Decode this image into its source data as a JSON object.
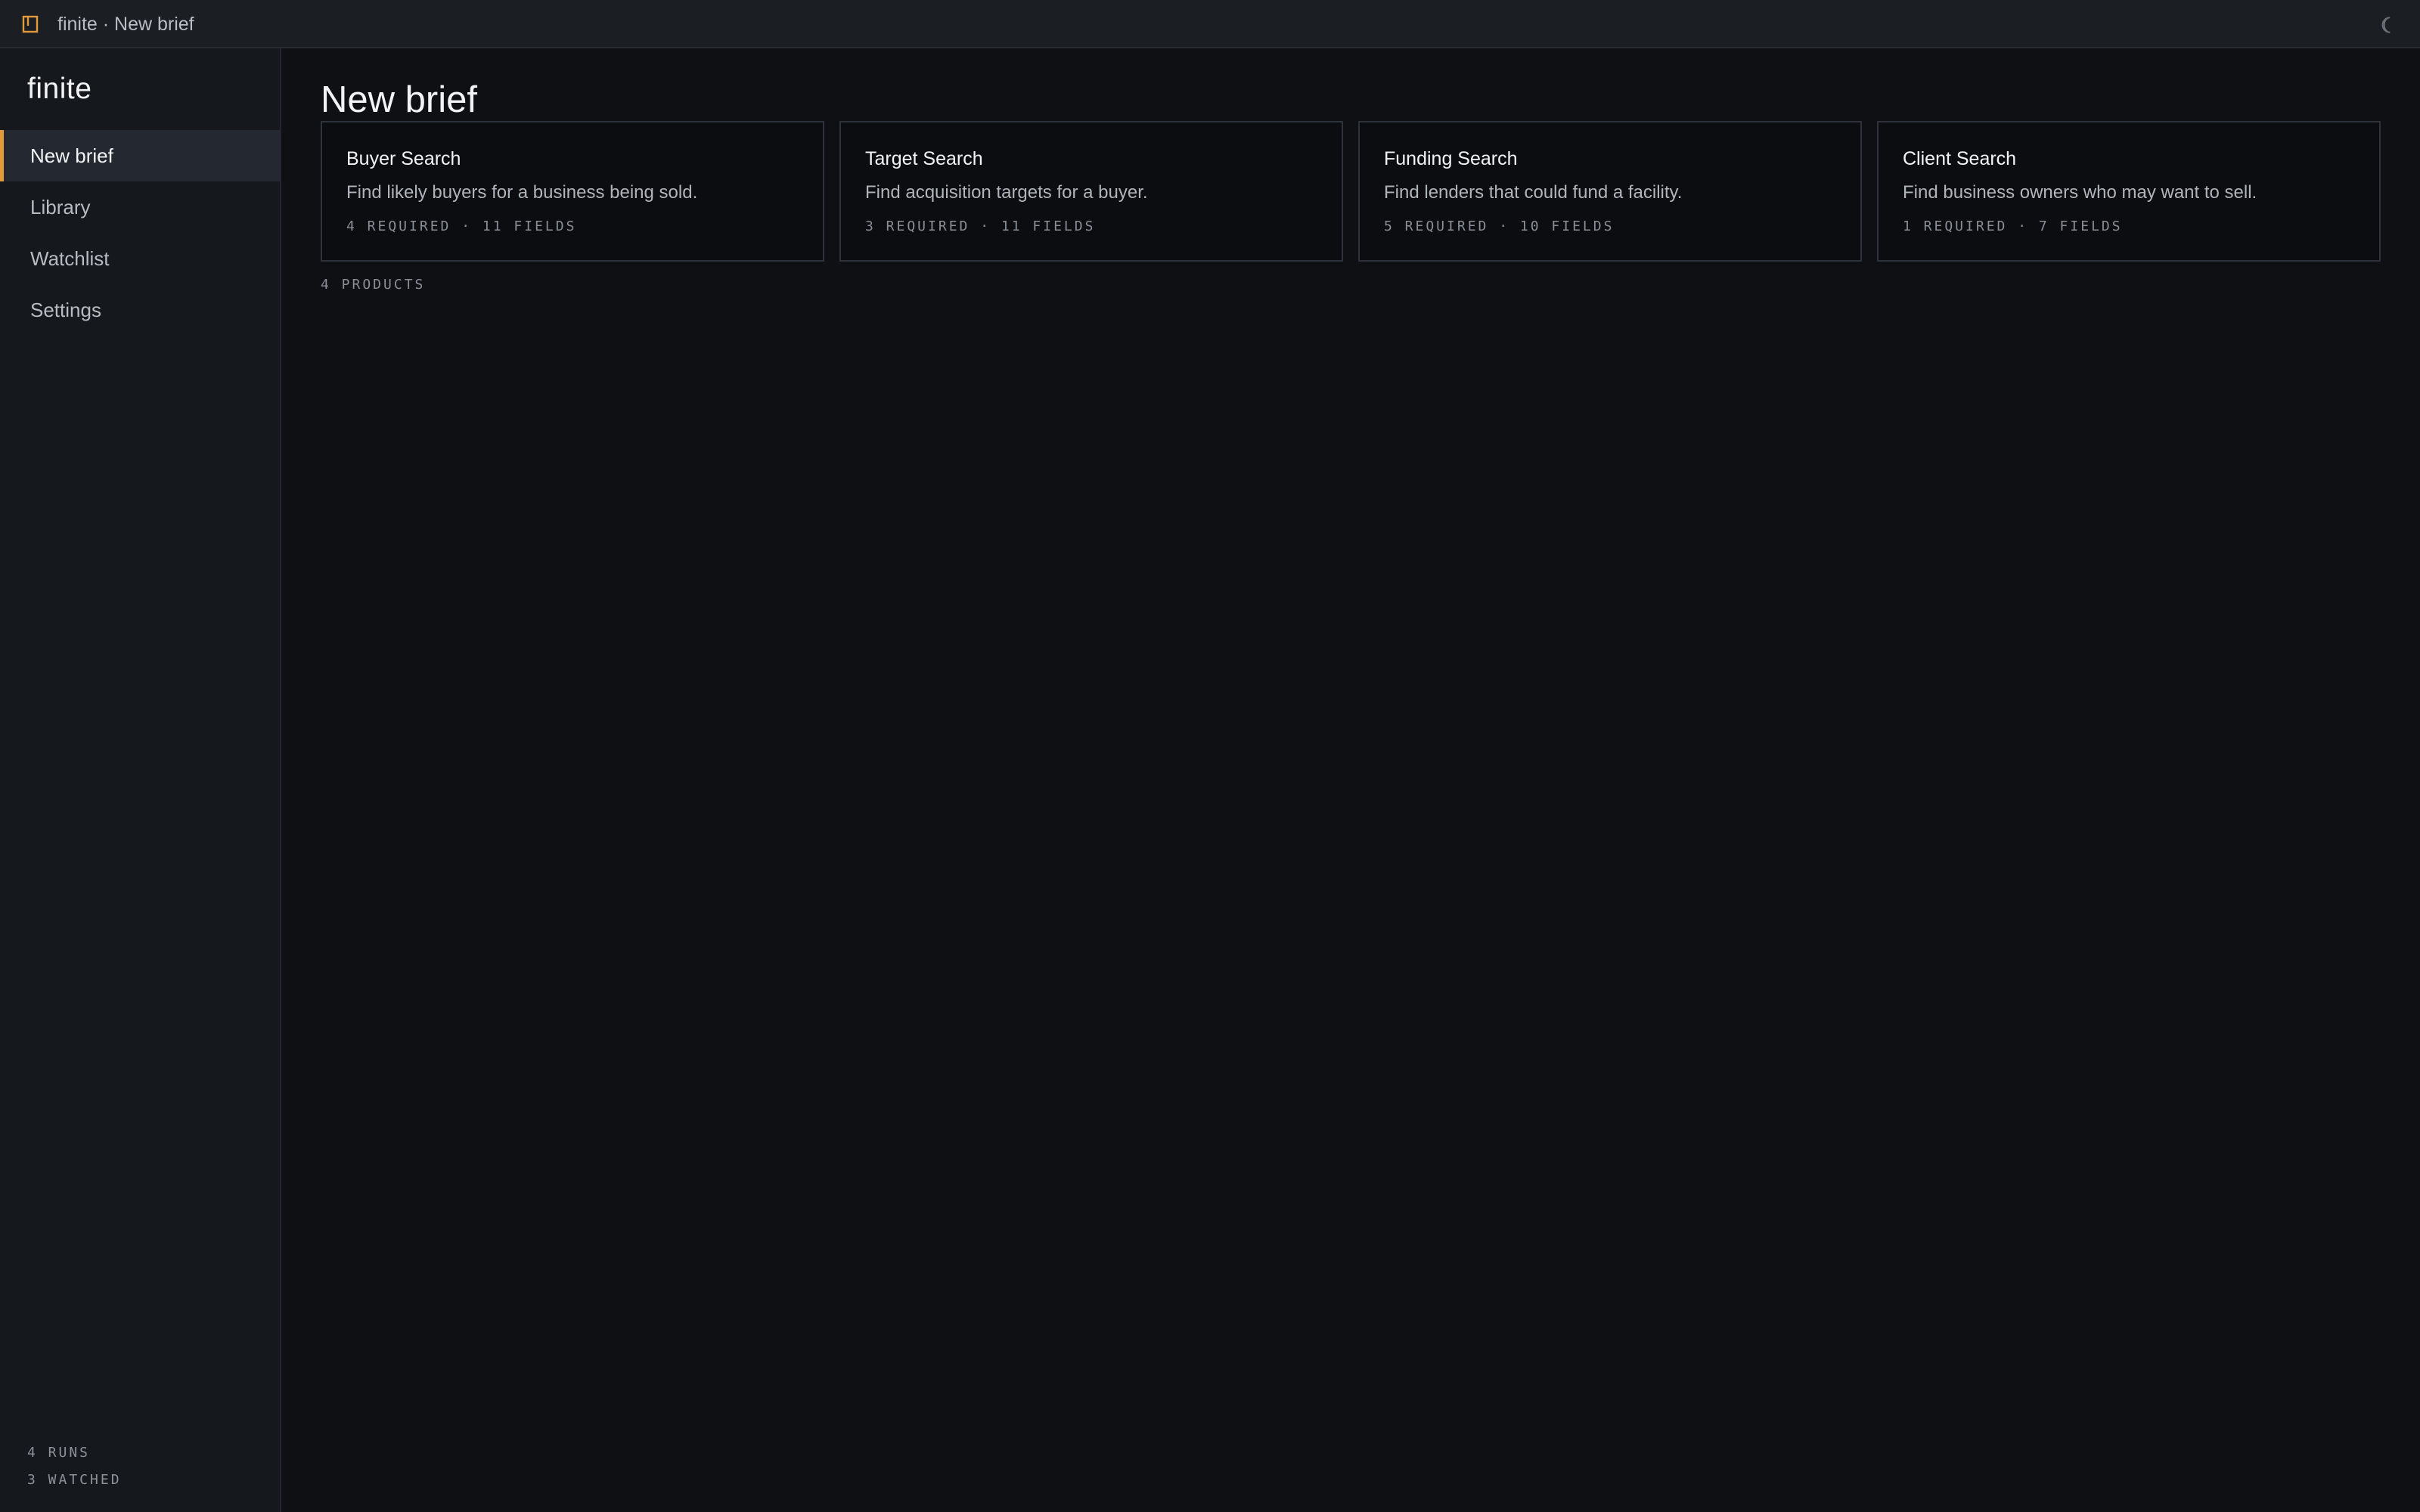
{
  "window": {
    "title": "finite · New brief",
    "accent_color": "#e29a3a",
    "icons": {
      "app": "book-icon",
      "theme_toggle": "moon-icon"
    }
  },
  "sidebar": {
    "brand": "finite",
    "items": [
      {
        "label": "New brief",
        "active": true
      },
      {
        "label": "Library",
        "active": false
      },
      {
        "label": "Watchlist",
        "active": false
      },
      {
        "label": "Settings",
        "active": false
      }
    ],
    "stats": {
      "runs": "4 RUNS",
      "watched": "3 WATCHED"
    }
  },
  "main": {
    "title": "New brief",
    "cards": [
      {
        "title": "Buyer Search",
        "description": "Find likely buyers for a business being sold.",
        "meta": "4 REQUIRED · 11 FIELDS"
      },
      {
        "title": "Target Search",
        "description": "Find acquisition targets for a buyer.",
        "meta": "3 REQUIRED · 11 FIELDS"
      },
      {
        "title": "Funding Search",
        "description": "Find lenders that could fund a facility.",
        "meta": "5 REQUIRED · 10 FIELDS"
      },
      {
        "title": "Client Search",
        "description": "Find business owners who may want to sell.",
        "meta": "1 REQUIRED · 7 FIELDS"
      }
    ],
    "products_count": "4 PRODUCTS"
  }
}
